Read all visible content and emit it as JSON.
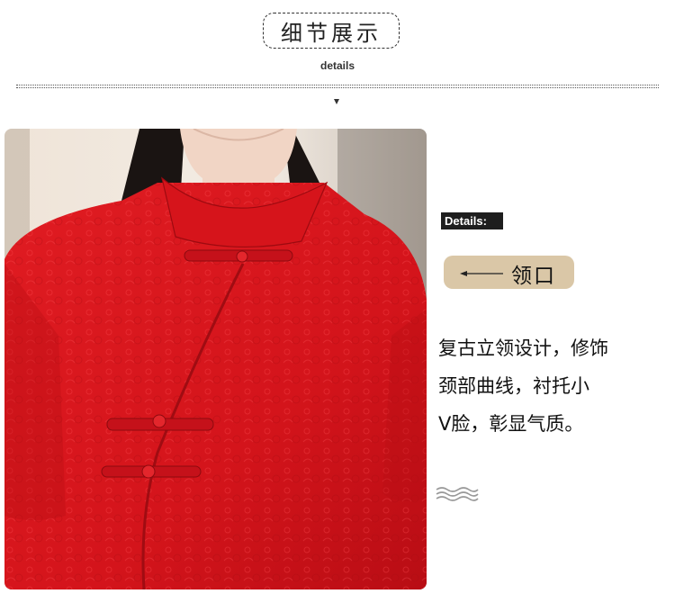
{
  "header": {
    "title": "细节展示",
    "subtitle": "details"
  },
  "photo": {
    "subject": "red-lace-qipao-collar",
    "colors": {
      "dress": "#d8141c",
      "background": "#efe6dc",
      "hair": "#1a1412"
    }
  },
  "detail_tag": "Details:",
  "part_label": "领口",
  "description_lines": [
    "复古立领设计，修饰",
    "颈部曲线，衬托小",
    "V脸，彰显气质。"
  ],
  "colors": {
    "accent_pill": "#dac7a7",
    "tag_bg": "#1e1e1e",
    "text": "#111111"
  },
  "icons": [
    "arrow-down-icon",
    "left-arrow-icon",
    "wave-icon"
  ]
}
